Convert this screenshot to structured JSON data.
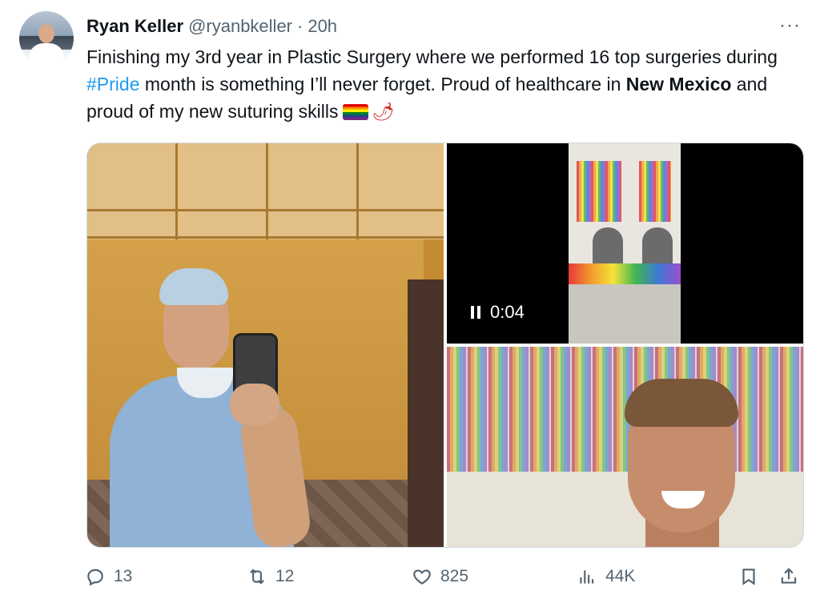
{
  "tweet": {
    "author_name": "Ryan Keller",
    "handle": "@ryanbkeller",
    "separator": "·",
    "time": "20h",
    "more_label": "···",
    "text": {
      "part1": "Finishing my 3rd year in Plastic Surgery where we performed 16 top surgeries during ",
      "hashtag": "#Pride",
      "part2": " month is something I’ll never forget. Proud of healthcare in ",
      "bold": "New Mexico",
      "part3": " and proud of my new suturing skills",
      "emoji_chili": "🌶"
    }
  },
  "media": {
    "video": {
      "time": "0:04"
    }
  },
  "actions": {
    "reply_count": "13",
    "retweet_count": "12",
    "like_count": "825",
    "views_count": "44K"
  },
  "icons": [
    "avatar",
    "more-icon",
    "pride-flag-icon",
    "chili-icon",
    "pause-icon",
    "reply-icon",
    "retweet-icon",
    "like-icon",
    "views-icon",
    "bookmark-icon",
    "share-icon"
  ],
  "colors": {
    "link": "#1d9bf0",
    "text": "#0f1419",
    "muted": "#536471",
    "border": "#cfd9de"
  }
}
